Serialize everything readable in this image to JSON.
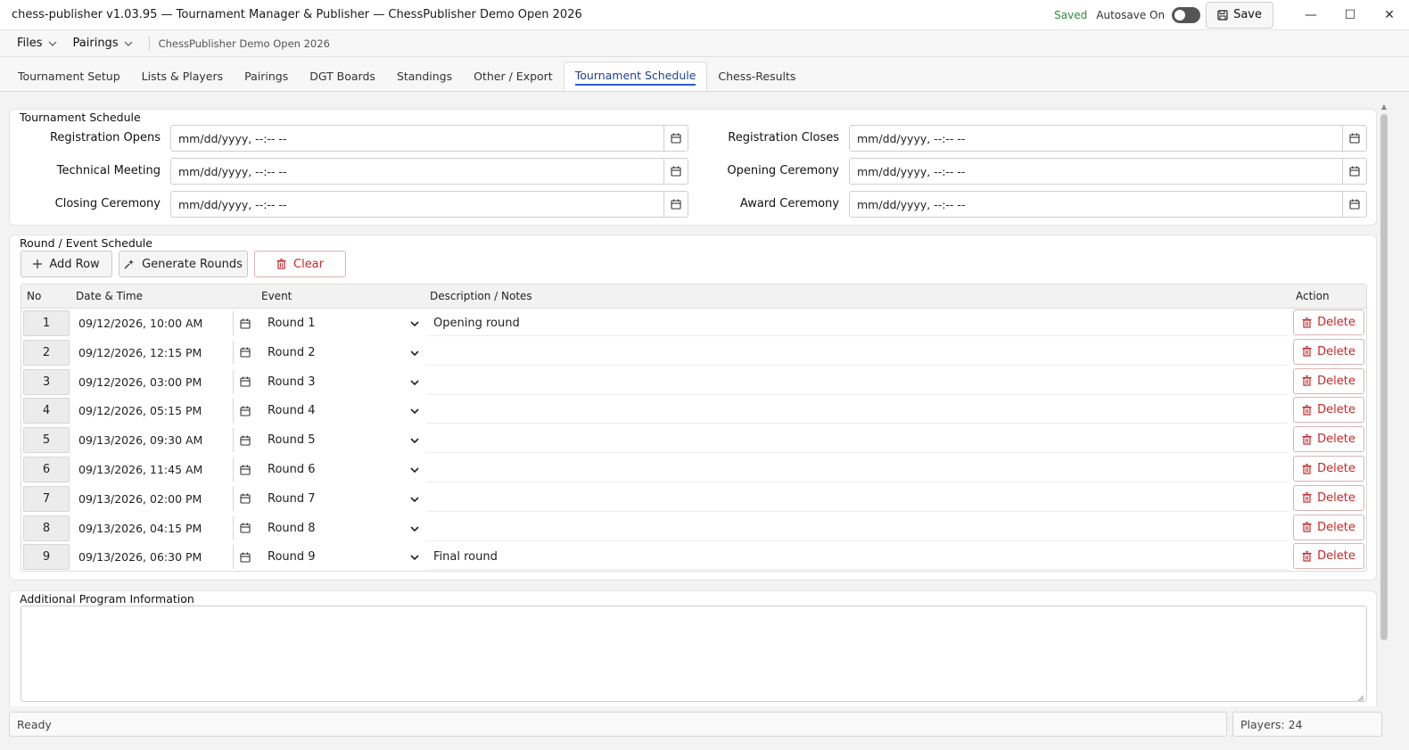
{
  "window": {
    "title": "chess-publisher v1.03.95 — Tournament Manager & Publisher — ChessPublisher Demo Open 2026",
    "saved_status": "Saved",
    "autosave_label": "Autosave On",
    "autosave_on": false,
    "save_label": "Save",
    "minimize_glyph": "—",
    "maximize_glyph": "☐",
    "close_glyph": "✕"
  },
  "menubar": {
    "files_label": "Files",
    "pairings_label": "Pairings",
    "document_name": "ChessPublisher Demo Open 2026"
  },
  "tabs": [
    {
      "label": "Tournament Setup"
    },
    {
      "label": "Lists & Players"
    },
    {
      "label": "Pairings"
    },
    {
      "label": "DGT Boards"
    },
    {
      "label": "Standings"
    },
    {
      "label": "Other / Export"
    },
    {
      "label": "Tournament Schedule",
      "active": true
    },
    {
      "label": "Chess-Results"
    }
  ],
  "schedule": {
    "title": "Tournament Schedule",
    "fields": {
      "registration_opens": {
        "label": "Registration Opens",
        "value": "mm/dd/yyyy, --:-- --"
      },
      "registration_closes": {
        "label": "Registration Closes",
        "value": "mm/dd/yyyy, --:-- --"
      },
      "technical_meeting": {
        "label": "Technical Meeting",
        "value": "mm/dd/yyyy, --:-- --"
      },
      "opening_ceremony": {
        "label": "Opening Ceremony",
        "value": "mm/dd/yyyy, --:-- --"
      },
      "closing_ceremony": {
        "label": "Closing Ceremony",
        "value": "mm/dd/yyyy, --:-- --"
      },
      "award_ceremony": {
        "label": "Award Ceremony",
        "value": "mm/dd/yyyy, --:-- --"
      }
    }
  },
  "rounds": {
    "title": "Round / Event Schedule",
    "add_row_label": "Add Row",
    "generate_label": "Generate Rounds",
    "clear_label": "Clear",
    "columns": {
      "no": "No",
      "datetime": "Date & Time",
      "event": "Event",
      "description": "Description / Notes",
      "action": "Action"
    },
    "delete_label": "Delete",
    "rows": [
      {
        "no": "1",
        "datetime": "09/12/2026, 10:00 AM",
        "event": "Round 1",
        "description": "Opening round"
      },
      {
        "no": "2",
        "datetime": "09/12/2026, 12:15 PM",
        "event": "Round 2",
        "description": ""
      },
      {
        "no": "3",
        "datetime": "09/12/2026, 03:00 PM",
        "event": "Round 3",
        "description": ""
      },
      {
        "no": "4",
        "datetime": "09/12/2026, 05:15 PM",
        "event": "Round 4",
        "description": ""
      },
      {
        "no": "5",
        "datetime": "09/13/2026, 09:30 AM",
        "event": "Round 5",
        "description": ""
      },
      {
        "no": "6",
        "datetime": "09/13/2026, 11:45 AM",
        "event": "Round 6",
        "description": ""
      },
      {
        "no": "7",
        "datetime": "09/13/2026, 02:00 PM",
        "event": "Round 7",
        "description": ""
      },
      {
        "no": "8",
        "datetime": "09/13/2026, 04:15 PM",
        "event": "Round 8",
        "description": ""
      },
      {
        "no": "9",
        "datetime": "09/13/2026, 06:30 PM",
        "event": "Round 9",
        "description": "Final round"
      }
    ]
  },
  "additional": {
    "title": "Additional Program Information",
    "value": ""
  },
  "status": {
    "left": "Ready",
    "players": "Players: 24"
  },
  "colors": {
    "accent": "#2c5cc5",
    "danger": "#c62828",
    "saved": "#2e8b3a"
  }
}
